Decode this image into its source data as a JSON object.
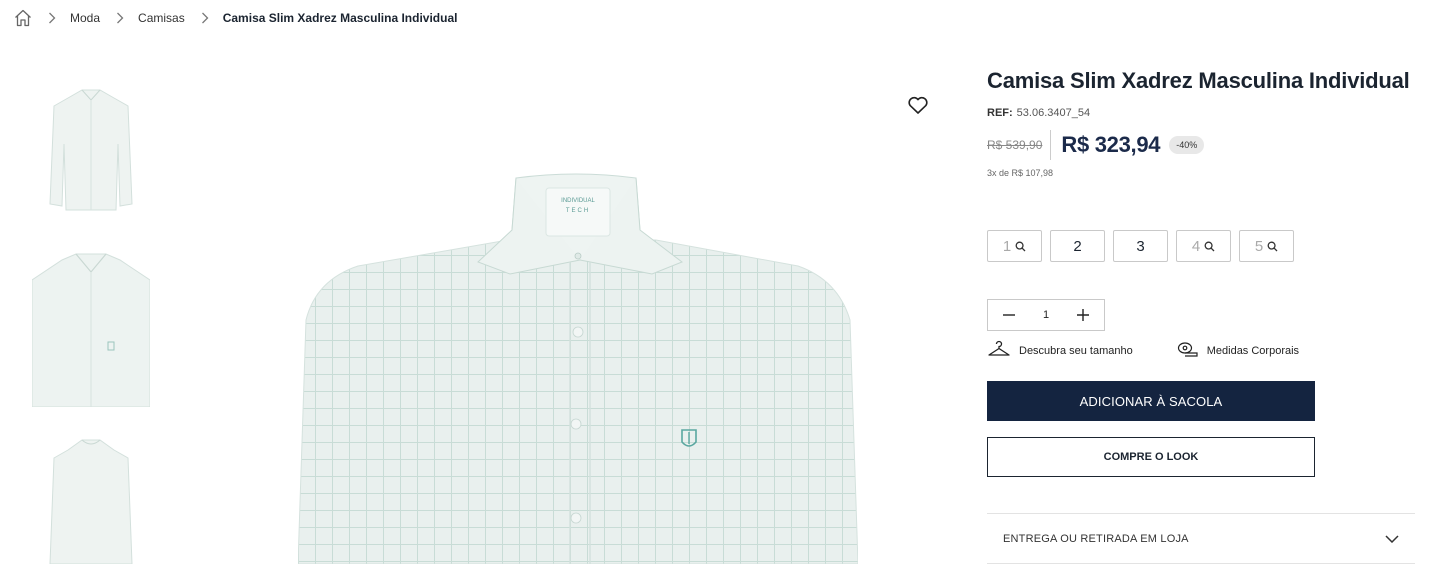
{
  "breadcrumb": {
    "items": [
      "Moda",
      "Camisas"
    ],
    "current": "Camisa Slim Xadrez Masculina Individual"
  },
  "product": {
    "title": "Camisa Slim Xadrez Masculina Individual",
    "ref_label": "REF:",
    "ref_value": "53.06.3407_54",
    "old_price": "R$ 539,90",
    "price": "R$ 323,94",
    "discount": "-40%",
    "installments": "3x de R$ 107,98"
  },
  "main_image": {
    "label_line1": "INDIVIDUAL",
    "label_line2": "TECH"
  },
  "sizes": [
    {
      "label": "1",
      "available": false
    },
    {
      "label": "2",
      "available": true
    },
    {
      "label": "3",
      "available": true
    },
    {
      "label": "4",
      "available": false
    },
    {
      "label": "5",
      "available": false
    }
  ],
  "quantity": {
    "value": "1"
  },
  "helpers": {
    "size_guide": "Descubra seu tamanho",
    "measures": "Medidas Corporais"
  },
  "buttons": {
    "add_to_bag": "ADICIONAR À SACOLA",
    "shop_look": "COMPRE O LOOK"
  },
  "accordion": {
    "delivery": "ENTREGA OU RETIRADA EM LOJA"
  },
  "colors": {
    "navy": "#142440",
    "shirt": "#e9f0ee",
    "shirt_line": "#c5d9d3",
    "accent_teal": "#5aa7a0"
  }
}
